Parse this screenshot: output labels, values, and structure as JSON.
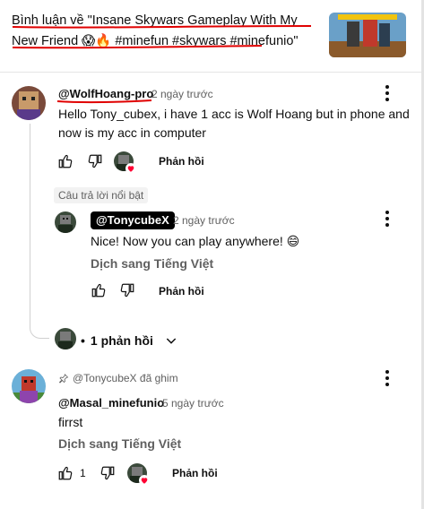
{
  "header": {
    "title": "Bình luận về \"Insane Skywars Gameplay With My New Friend 😱🔥 #minefun #skywars #minefunio\""
  },
  "comments": [
    {
      "handle": "@WolfHoang-pro",
      "time": "2 ngày trước",
      "text": "Hello Tony_cubex, i have 1 acc is Wolf Hoang but in phone and now is my acc in computer",
      "reply_label": "Phản hồi"
    },
    {
      "handle": "@Masal_minefunio",
      "time": "5 ngày trước",
      "pinned_by": "@TonycubeX đã ghim",
      "text": "firrst",
      "translate": "Dịch sang Tiếng Việt",
      "likes": "1",
      "reply_label": "Phản hồi"
    }
  ],
  "reply": {
    "badge": "Câu trả lời nổi bật",
    "handle": "@TonycubeX",
    "time": "2 ngày trước",
    "text": "Nice! Now you can play anywhere! 😄",
    "translate": "Dịch sang Tiếng Việt",
    "reply_label": "Phản hồi"
  },
  "replies_toggle": {
    "bullet": "•",
    "label": "1 phản hồi"
  },
  "icons": {
    "like": "thumbs-up-icon",
    "dislike": "thumbs-down-icon",
    "menu": "more-vert-icon",
    "pin": "pin-icon",
    "chevron": "chevron-down-icon",
    "heart": "heart-icon"
  },
  "colors": {
    "underline_red": "#e00000",
    "heart_red": "#ff0033",
    "text_secondary": "#606060"
  }
}
